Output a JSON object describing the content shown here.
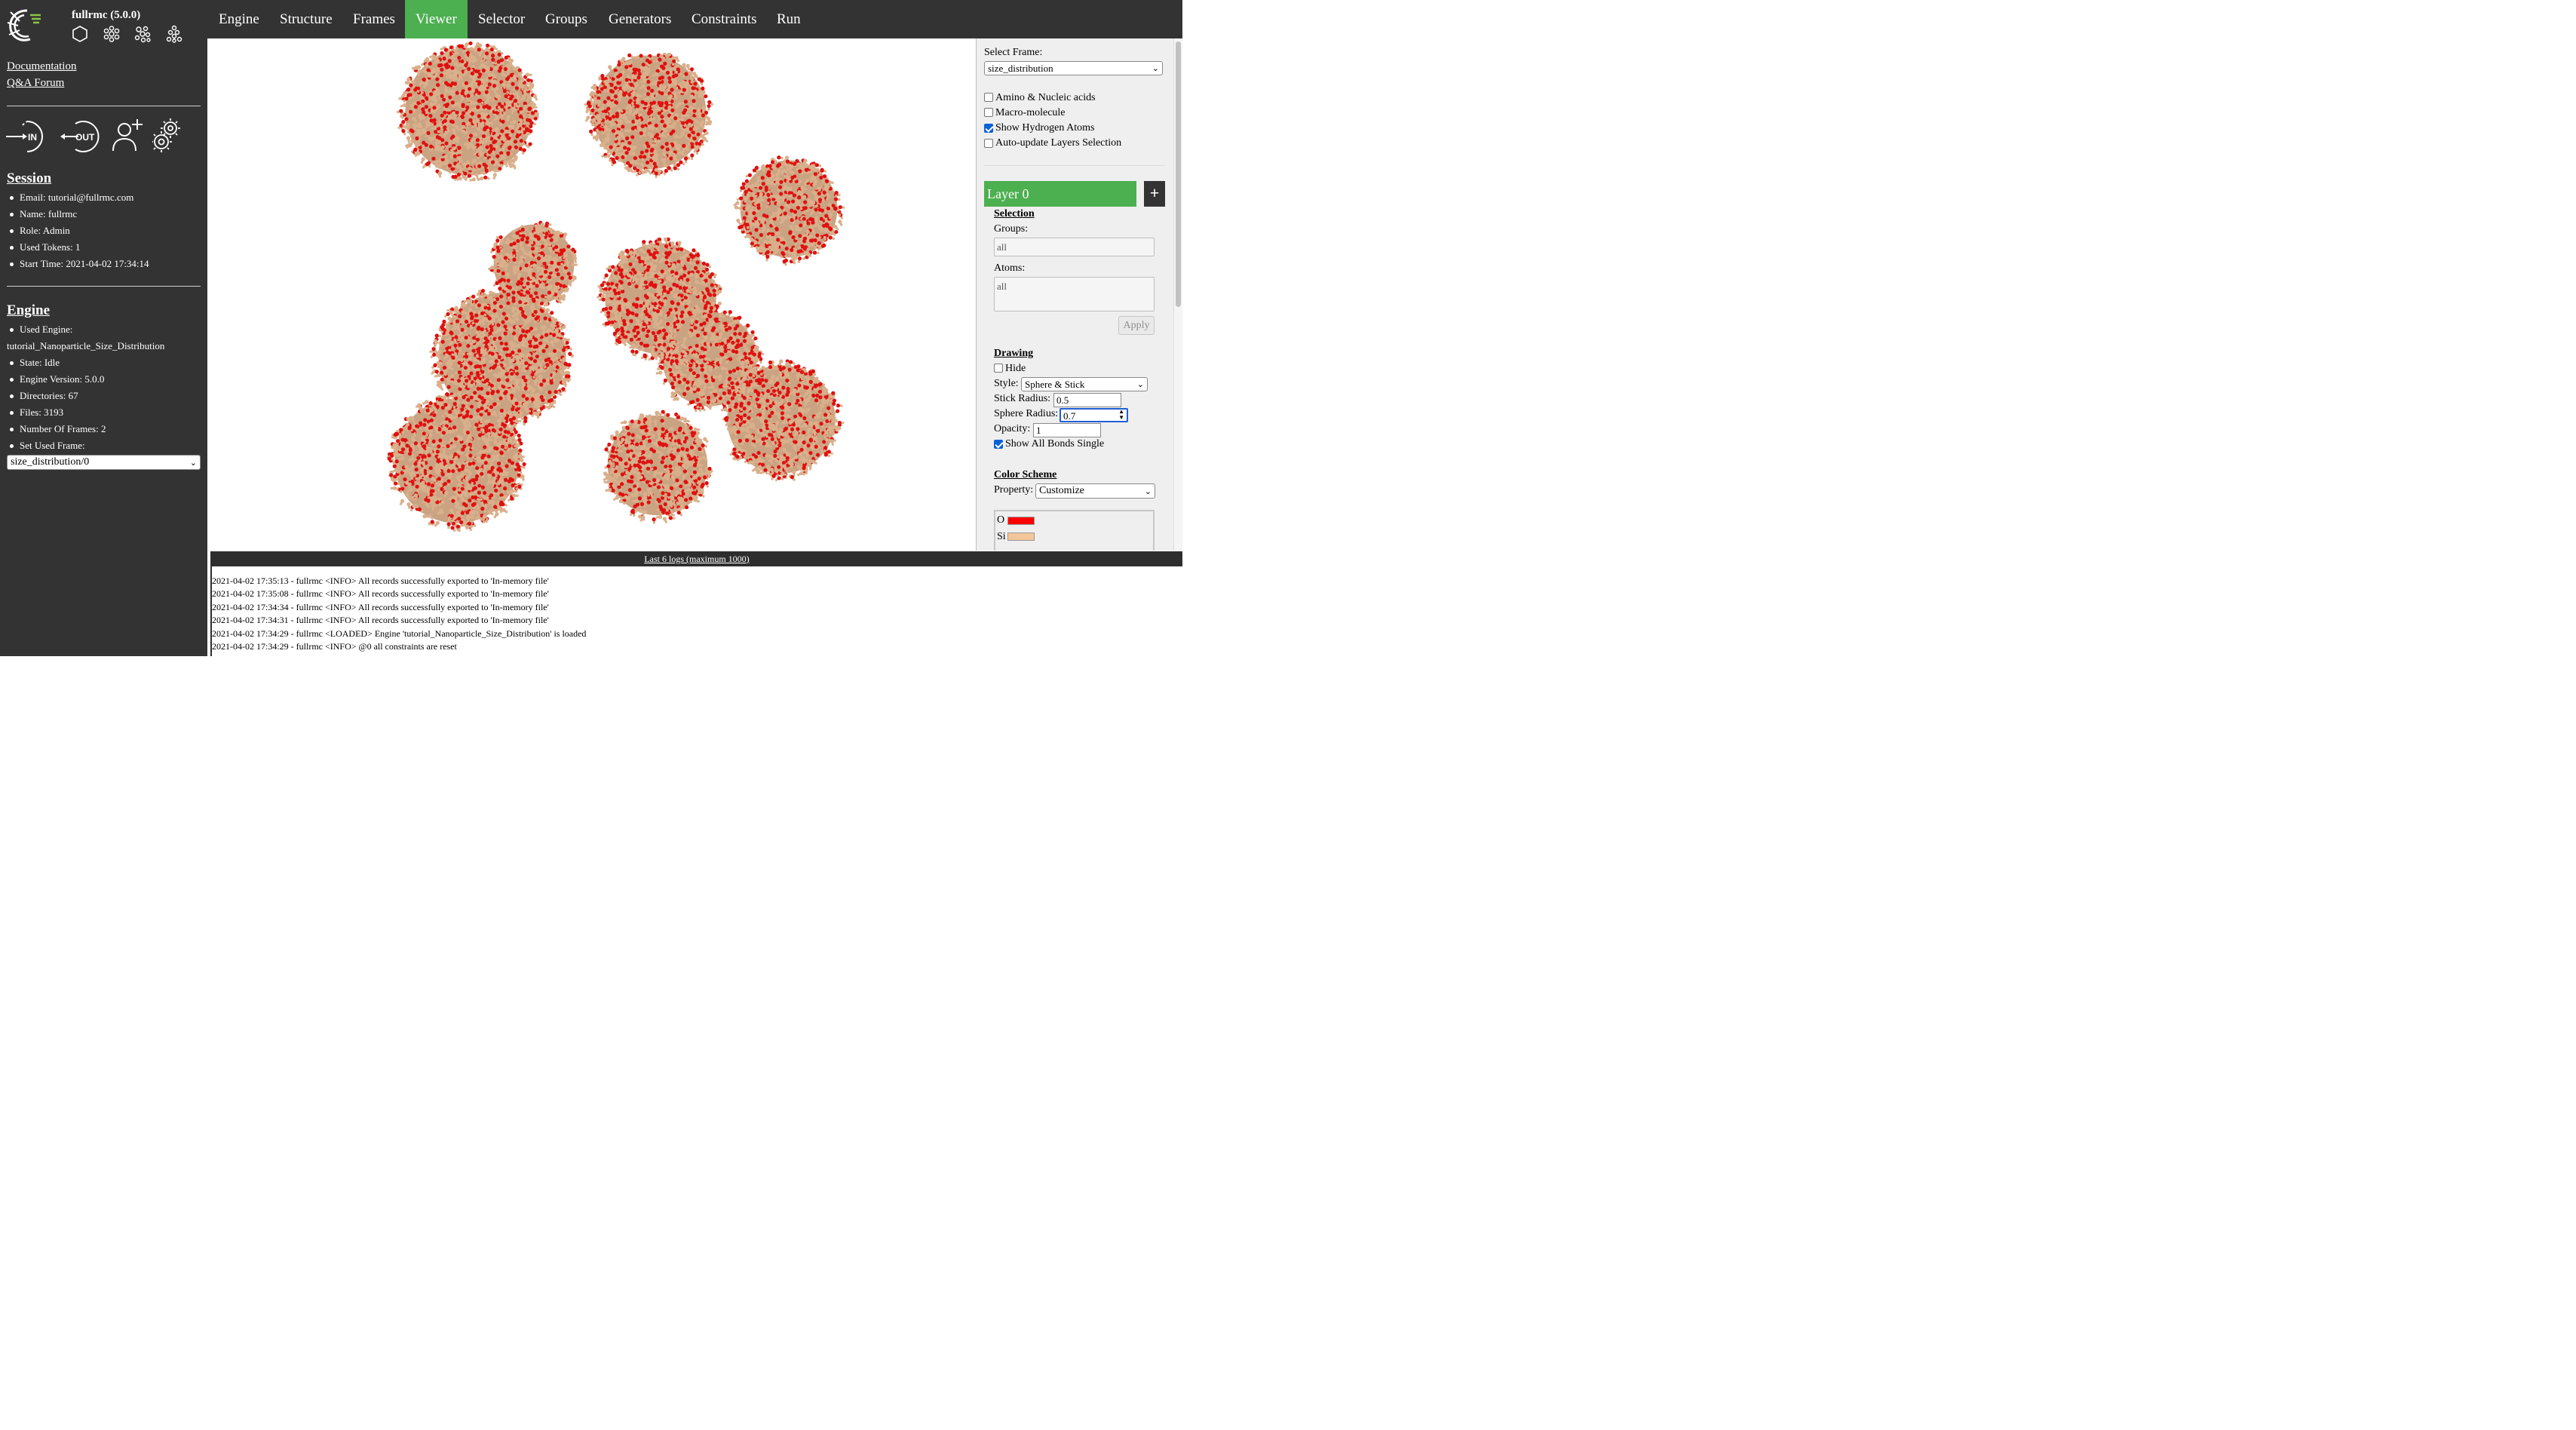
{
  "app": {
    "title": "fullrmc (5.0.0)",
    "logo_icon": "fullrmc-logo-icon",
    "top_icons": [
      "hexagon-icon",
      "flower-molecule-icon",
      "cluster-molecule-icon",
      "cluster-small-molecule-icon"
    ]
  },
  "sidebar": {
    "links": [
      "Documentation",
      "Q&A Forum"
    ],
    "actions": [
      {
        "icon": "login-in-icon",
        "label": "IN"
      },
      {
        "icon": "logout-out-icon",
        "label": "OUT"
      },
      {
        "icon": "add-user-icon"
      },
      {
        "icon": "gear-icon"
      }
    ],
    "session": {
      "title": "Session",
      "email": "Email: tutorial@fullrmc.com",
      "name": "Name: fullrmc",
      "role": "Role: Admin",
      "tokens": "Used Tokens: 1",
      "start_time": "Start Time: 2021-04-02 17:34:14"
    },
    "engine": {
      "title": "Engine",
      "used_engine_label": "Used Engine:",
      "used_engine_value": "tutorial_Nanoparticle_Size_Distribution",
      "state": "State: Idle",
      "version": "Engine Version: 5.0.0",
      "directories": "Directories: 67",
      "files": "Files: 3193",
      "frames": "Number Of Frames: 2",
      "set_frame_label": "Set Used Frame:",
      "set_frame_value": "size_distribution/0"
    }
  },
  "nav": {
    "items": [
      "Engine",
      "Structure",
      "Frames",
      "Viewer",
      "Selector",
      "Groups",
      "Generators",
      "Constraints",
      "Run"
    ],
    "active": "Viewer",
    "active_color": "#4caf50"
  },
  "panel": {
    "select_frame_label": "Select Frame:",
    "select_frame_value": "size_distribution",
    "checkboxes": {
      "amino": {
        "label": "Amino & Nucleic acids",
        "checked": false
      },
      "macro": {
        "label": "Macro-molecule",
        "checked": false
      },
      "hydrogen": {
        "label": "Show Hydrogen Atoms",
        "checked": true
      },
      "auto_update": {
        "label": "Auto-update Layers Selection",
        "checked": false
      }
    },
    "layer": {
      "title": "Layer 0",
      "add_label": "+",
      "selection_title": "Selection",
      "groups_label": "Groups:",
      "groups_value": "all",
      "atoms_label": "Atoms:",
      "atoms_value": "all",
      "apply_label": "Apply",
      "drawing_title": "Drawing",
      "hide_label": "Hide",
      "hide_checked": false,
      "style_label": "Style:",
      "style_value": "Sphere & Stick",
      "stick_radius_label": "Stick Radius:",
      "stick_radius_value": "0.5",
      "sphere_radius_label": "Sphere Radius:",
      "sphere_radius_value": "0.7",
      "opacity_label": "Opacity:",
      "opacity_value": "1",
      "bonds_label": "Show All Bonds Single",
      "bonds_checked": true,
      "color_scheme_title": "Color Scheme",
      "property_label": "Property:",
      "property_value": "Customize",
      "colors": [
        {
          "element": "O",
          "color": "#ff0000"
        },
        {
          "element": "Si",
          "color": "#f2c69a"
        }
      ]
    }
  },
  "logs": {
    "header": "Last 6 logs (maximum 1000)",
    "lines": [
      "2021-04-02 17:35:13 - fullrmc <INFO> All records successfully exported to 'In-memory file'",
      "2021-04-02 17:35:08 - fullrmc <INFO> All records successfully exported to 'In-memory file'",
      "2021-04-02 17:34:34 - fullrmc <INFO> All records successfully exported to 'In-memory file'",
      "2021-04-02 17:34:31 - fullrmc <INFO> All records successfully exported to 'In-memory file'",
      "2021-04-02 17:34:29 - fullrmc <LOADED> Engine 'tutorial_Nanoparticle_Size_Distribution' is loaded",
      "2021-04-02 17:34:29 - fullrmc <INFO> @0 all constraints are reset"
    ]
  },
  "viewer": {
    "atom_colors": {
      "O": "#e01010",
      "Si": "#d9b08c"
    }
  }
}
